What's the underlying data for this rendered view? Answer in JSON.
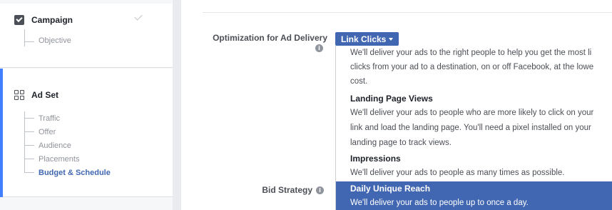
{
  "sidebar": {
    "campaign": {
      "title": "Campaign",
      "items": [
        "Objective"
      ]
    },
    "adset": {
      "title": "Ad Set",
      "items": [
        "Traffic",
        "Offer",
        "Audience",
        "Placements",
        "Budget & Schedule"
      ],
      "active_item": "Budget & Schedule"
    }
  },
  "main": {
    "optimization_label": "Optimization for Ad Delivery",
    "dropdown_value": "Link Clicks",
    "bid_strategy_label": "Bid Strategy",
    "menu": {
      "link_clicks_desc": [
        "We'll deliver your ads to the right people to help you get the most li",
        "clicks from your ad to a destination, on or off Facebook, at the lowe",
        "cost."
      ],
      "landing_page_views": {
        "name": "Landing Page Views",
        "desc": [
          "We'll deliver your ads to people who are more likely to click on your",
          "link and load the landing page. You'll need a pixel installed on your",
          "landing page to track views."
        ]
      },
      "impressions": {
        "name": "Impressions",
        "desc": [
          "We'll deliver your ads to people as many times as possible."
        ]
      },
      "daily_unique_reach": {
        "name": "Daily Unique Reach",
        "desc": [
          "We'll deliver your ads to people up to once a day."
        ]
      }
    }
  },
  "colors": {
    "accent": "#4267b2",
    "active_bar": "#4080ff"
  }
}
